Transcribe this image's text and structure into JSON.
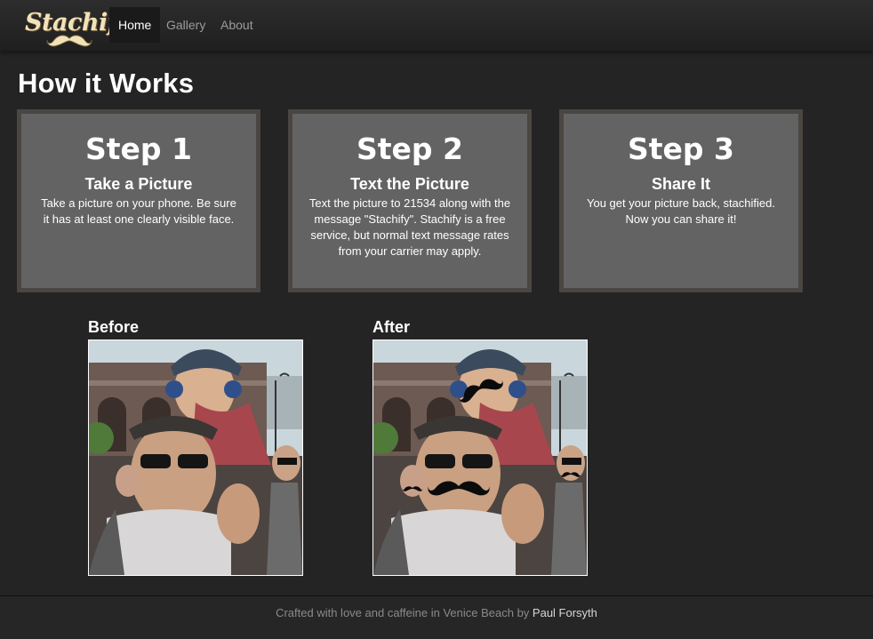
{
  "brand": {
    "name": "Stachify"
  },
  "nav": {
    "items": [
      {
        "label": "Home",
        "active": true
      },
      {
        "label": "Gallery",
        "active": false
      },
      {
        "label": "About",
        "active": false
      }
    ]
  },
  "page": {
    "title": "How it Works"
  },
  "steps": [
    {
      "number": "Step 1",
      "title": "Take a Picture",
      "description": "Take a picture on your phone. Be sure it has at least one clearly visible face."
    },
    {
      "number": "Step 2",
      "title": "Text the Picture",
      "description": "Text the picture to 21534 along with the message \"Stachify\". Stachify is a free service, but normal text message rates from your carrier may apply."
    },
    {
      "number": "Step 3",
      "title": "Share It",
      "description": "You get your picture back, stachified. Now you can share it!"
    }
  ],
  "photos": {
    "before": {
      "label": "Before"
    },
    "after": {
      "label": "After"
    }
  },
  "footer": {
    "text": "Crafted with love and caffeine in Venice Beach by ",
    "author": "Paul Forsyth"
  },
  "colors": {
    "background": "#242424",
    "card": "#636363",
    "card_border": "#4a4641",
    "brand": "#f2e2b8"
  }
}
